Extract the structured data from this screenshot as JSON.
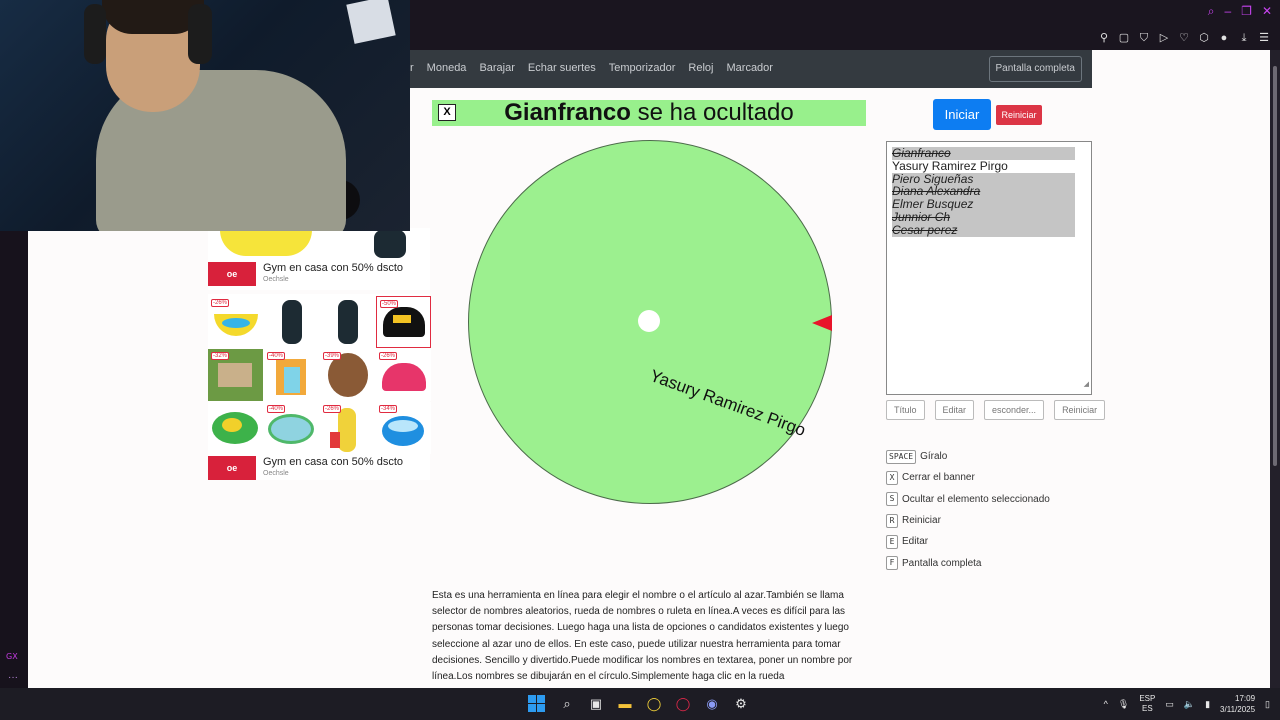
{
  "nav": {
    "items": [
      "r",
      "Moneda",
      "Barajar",
      "Echar suertes",
      "Temporizador",
      "Reloj",
      "Marcador"
    ],
    "fullscreen_label": "Pantalla completa"
  },
  "banner": {
    "close_label": "X",
    "name": "Gianfranco",
    "text": " se ha ocultado"
  },
  "controls": {
    "start_label": "Iniciar",
    "reset_label": "Reiniciar"
  },
  "wheel": {
    "label": "Yasury Ramirez Pirgo",
    "color": "#9cf08f",
    "pointer_color": "#e8142a"
  },
  "names": [
    {
      "text": "Gianfranco",
      "hidden": true,
      "struck": true
    },
    {
      "text": "Yasury Ramirez Pirgo",
      "hidden": false,
      "struck": false
    },
    {
      "text": "Piero Sigueñas",
      "hidden": true,
      "struck": false
    },
    {
      "text": "Diana Alexandra",
      "hidden": true,
      "struck": true
    },
    {
      "text": "Elmer Busquez",
      "hidden": true,
      "struck": false
    },
    {
      "text": "Junnior Ch",
      "hidden": true,
      "struck": true
    },
    {
      "text": "Cesar perez",
      "hidden": true,
      "struck": true
    }
  ],
  "editor_buttons": [
    "Título",
    "Editar",
    "esconder...",
    "Reiniciar"
  ],
  "shortcuts": [
    {
      "key": "SPACE",
      "label": "Gíralo"
    },
    {
      "key": "X",
      "label": "Cerrar el banner"
    },
    {
      "key": "S",
      "label": "Ocultar el elemento seleccionado"
    },
    {
      "key": "R",
      "label": "Reiniciar"
    },
    {
      "key": "E",
      "label": "Editar"
    },
    {
      "key": "F",
      "label": "Pantalla completa"
    }
  ],
  "description": "Esta es una herramienta en línea para elegir el nombre o el artículo al azar.También se llama selector de nombres aleatorios, rueda de nombres o ruleta en línea.A veces es difícil para las personas tomar decisiones. Luego haga una lista de opciones o candidatos existentes y luego seleccione al azar uno de ellos. En este caso, puede utilizar nuestra herramienta para tomar decisiones. Sencillo y divertido.Puede modificar los nombres en textarea, poner un nombre por línea.Los nombres se dibujarán en el círculo.Simplemente haga clic en la rueda",
  "ads": {
    "logo_text": "oe",
    "title": "Gym en casa con 50% dscto",
    "advertiser": "Oechsle",
    "badges": [
      "-26%",
      "",
      "",
      "-50%",
      "-32%",
      "-40%",
      "-39%",
      "-26%",
      "",
      "-40%",
      "-26%",
      "-34%"
    ]
  },
  "browser": {
    "gx_label": "GX"
  },
  "taskbar": {
    "lang_top": "ESP",
    "lang_bottom": "ES",
    "time": "17:09",
    "date": "3/11/2025"
  }
}
